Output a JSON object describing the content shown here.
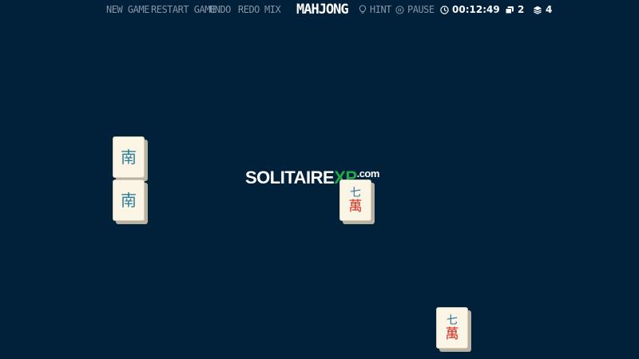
{
  "menu": {
    "new_game": "NEW GAME",
    "restart_game": "RESTART GAME",
    "undo": "UNDO",
    "redo": "REDO",
    "mix": "MIX"
  },
  "title": "MAHJONG",
  "controls": {
    "hint": "HINT",
    "pause": "PAUSE",
    "timer": "00:12:49",
    "matches_available": "2",
    "tiles_left": "4"
  },
  "logo": {
    "brand": "SOLITAIRE",
    "xp": "XP",
    "suffix": ".com"
  },
  "tiles": [
    {
      "id": "south-wind-1",
      "glyph": "南",
      "kind": "wind"
    },
    {
      "id": "south-wind-2",
      "glyph": "南",
      "kind": "wind"
    },
    {
      "id": "seven-wan-1",
      "number": "七",
      "suit": "萬",
      "kind": "character"
    },
    {
      "id": "seven-wan-2",
      "number": "七",
      "suit": "萬",
      "kind": "character"
    }
  ],
  "colors": {
    "background": "#01213a",
    "menu_text": "#8694a4",
    "tile_face": "#fbf5e6",
    "wind_glyph": "#2e7d9a",
    "wan_glyph": "#d22a1c",
    "logo_accent": "#21a84b"
  },
  "icons": {
    "hint": "lightbulb-icon",
    "pause": "pause-icon",
    "timer": "clock-icon",
    "matches": "cards-icon",
    "tiles": "layers-icon"
  }
}
